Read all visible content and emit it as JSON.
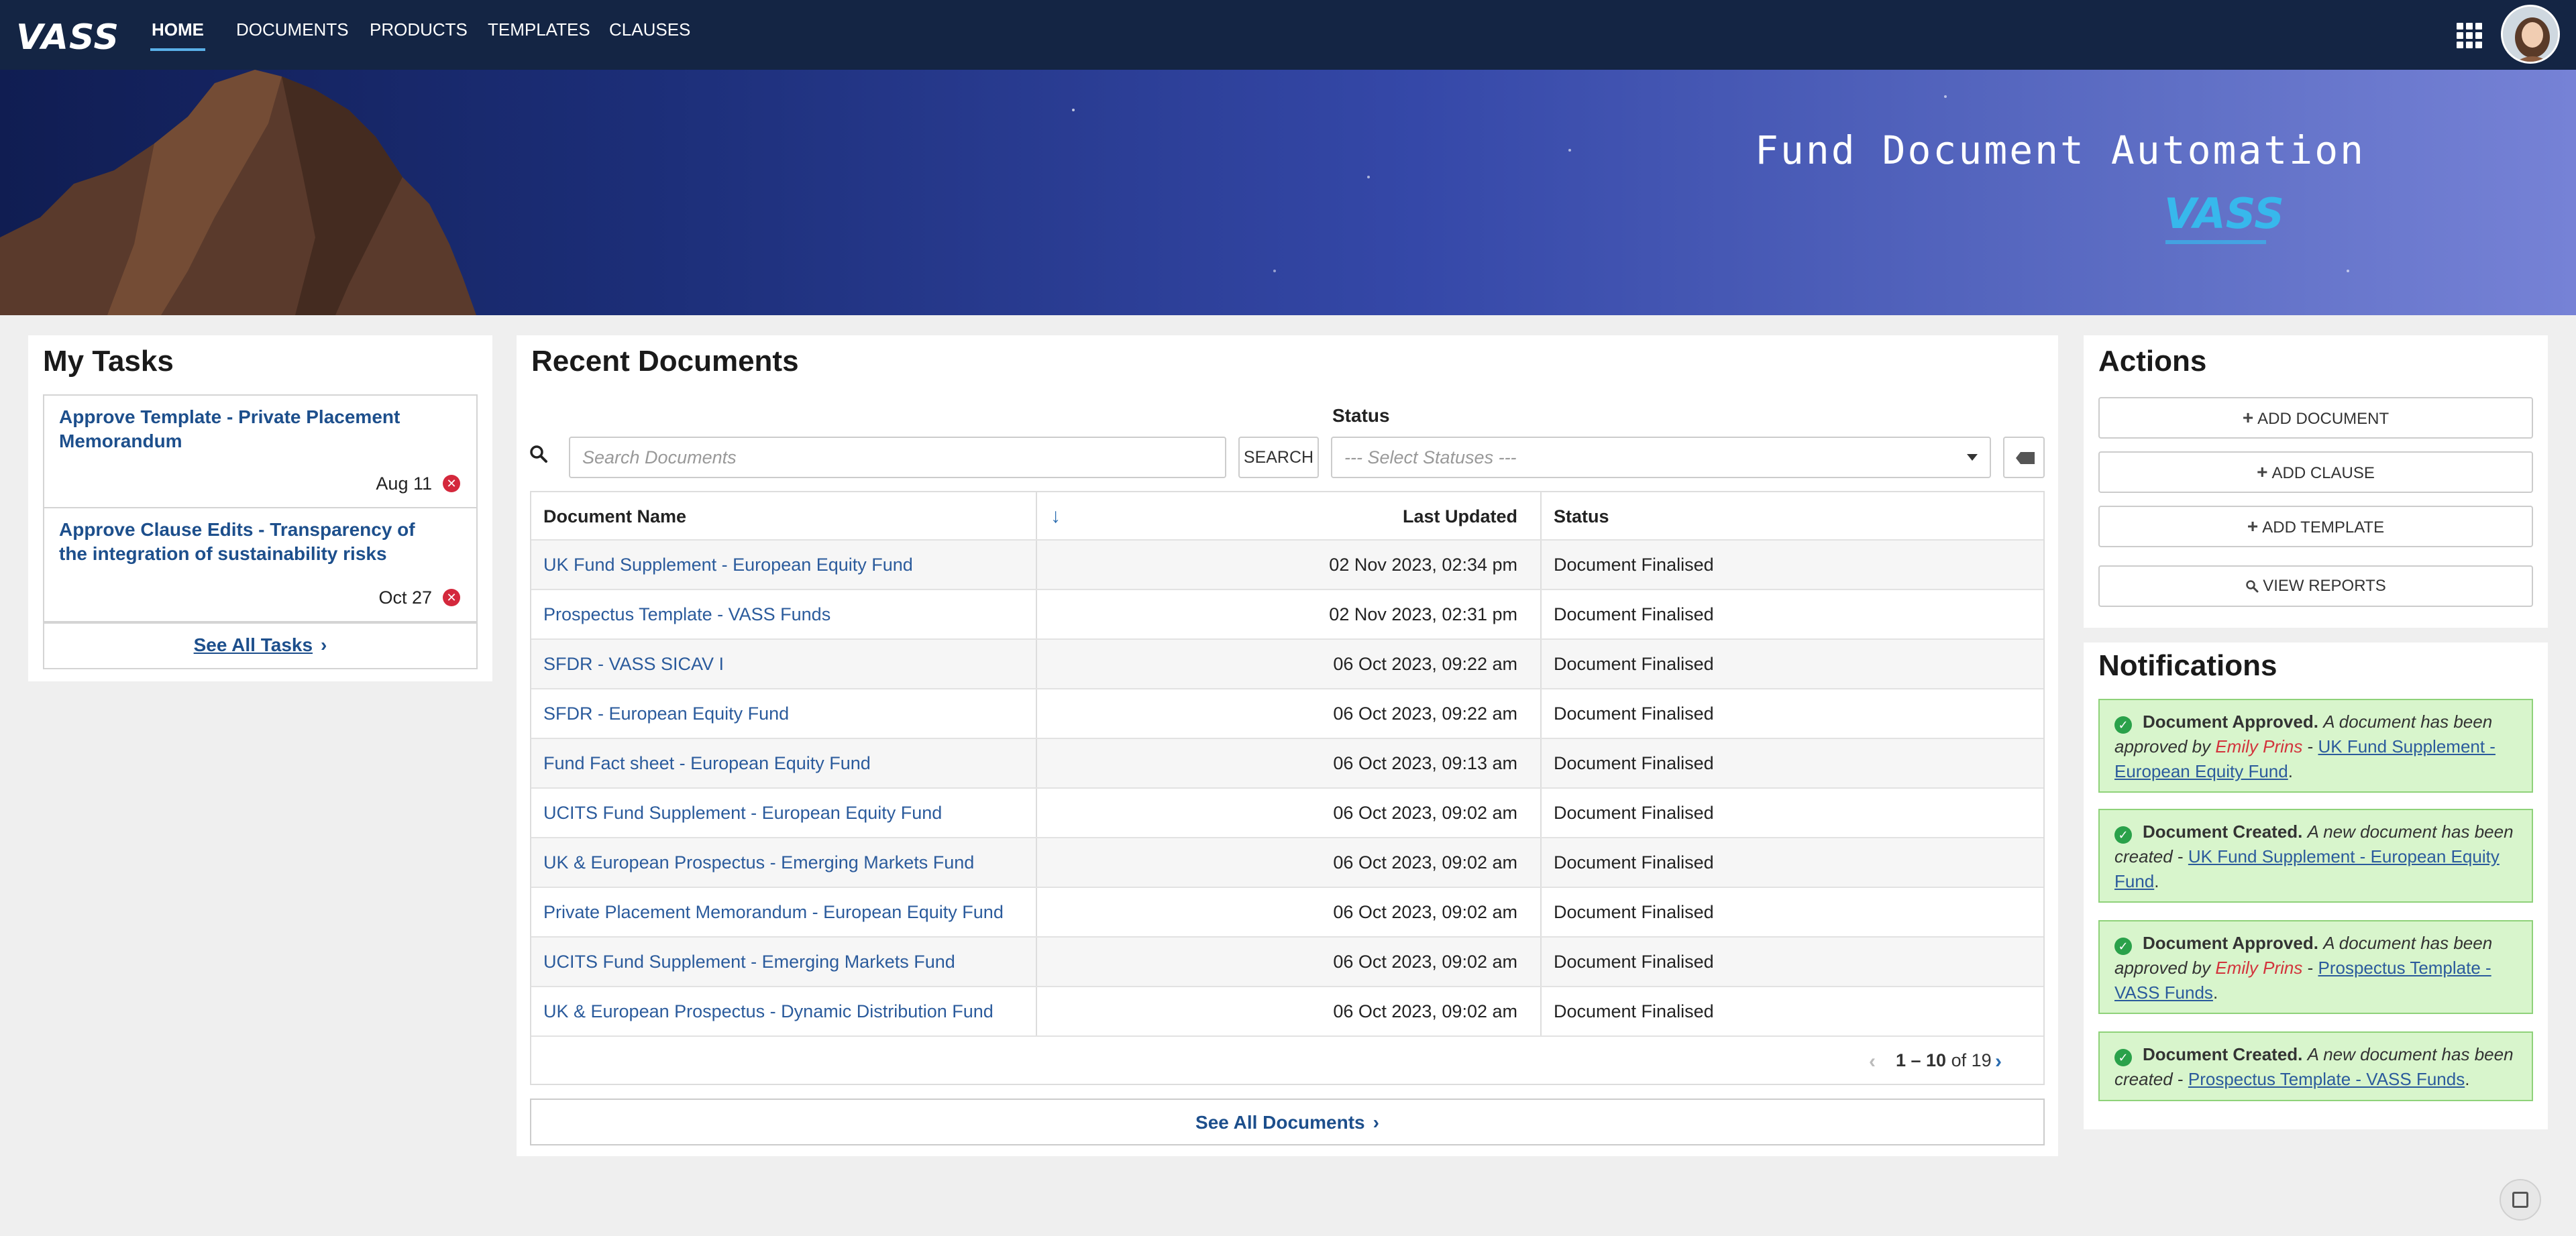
{
  "nav": {
    "logo": "VASS",
    "items": [
      "HOME",
      "DOCUMENTS",
      "PRODUCTS",
      "TEMPLATES",
      "CLAUSES"
    ],
    "active": "HOME",
    "apps_icon": "grid-icon",
    "avatar_icon": "user-avatar"
  },
  "banner": {
    "title": "Fund Document Automation",
    "logo": "VASS"
  },
  "tasks": {
    "title": "My Tasks",
    "items": [
      {
        "title": "Approve Template - Private Placement Memorandum",
        "date": "Aug 11"
      },
      {
        "title": "Approve Clause Edits - Transparency of the integration of sustainability risks",
        "date": "Oct 27"
      }
    ],
    "see_all": "See All Tasks"
  },
  "documents": {
    "title": "Recent Documents",
    "search_placeholder": "Search Documents",
    "search_button": "SEARCH",
    "status_label": "Status",
    "status_placeholder": "--- Select Statuses ---",
    "columns": {
      "name": "Document Name",
      "updated": "Last Updated",
      "status": "Status"
    },
    "rows": [
      {
        "name": "UK Fund Supplement - European Equity Fund",
        "updated": "02 Nov 2023, 02:34 pm",
        "status": "Document Finalised"
      },
      {
        "name": "Prospectus Template - VASS Funds",
        "updated": "02 Nov 2023, 02:31 pm",
        "status": "Document Finalised"
      },
      {
        "name": "SFDR - VASS SICAV I",
        "updated": "06 Oct 2023, 09:22 am",
        "status": "Document Finalised"
      },
      {
        "name": "SFDR - European Equity Fund",
        "updated": "06 Oct 2023, 09:22 am",
        "status": "Document Finalised"
      },
      {
        "name": "Fund Fact sheet - European Equity Fund",
        "updated": "06 Oct 2023, 09:13 am",
        "status": "Document Finalised"
      },
      {
        "name": "UCITS Fund Supplement - European Equity Fund",
        "updated": "06 Oct 2023, 09:02 am",
        "status": "Document Finalised"
      },
      {
        "name": "UK & European Prospectus - Emerging Markets Fund",
        "updated": "06 Oct 2023, 09:02 am",
        "status": "Document Finalised"
      },
      {
        "name": "Private Placement Memorandum - European Equity Fund",
        "updated": "06 Oct 2023, 09:02 am",
        "status": "Document Finalised"
      },
      {
        "name": "UCITS Fund Supplement - Emerging Markets Fund",
        "updated": "06 Oct 2023, 09:02 am",
        "status": "Document Finalised"
      },
      {
        "name": "UK & European Prospectus - Dynamic Distribution Fund",
        "updated": "06 Oct 2023, 09:02 am",
        "status": "Document Finalised"
      }
    ],
    "pager": {
      "range": "1 – 10",
      "of_label": "of",
      "total": "19"
    },
    "see_all": "See All Documents"
  },
  "actions": {
    "title": "Actions",
    "buttons": [
      {
        "label": "ADD DOCUMENT",
        "icon": "plus-icon"
      },
      {
        "label": "ADD CLAUSE",
        "icon": "plus-icon"
      },
      {
        "label": "ADD TEMPLATE",
        "icon": "plus-icon"
      },
      {
        "label": "VIEW REPORTS",
        "icon": "search-icon"
      }
    ]
  },
  "notifications": {
    "title": "Notifications",
    "items": [
      {
        "heading": "Document Approved.",
        "message": "A document has been approved by",
        "user": "Emily Prins",
        "sep": "-",
        "link": "UK Fund Supplement - European Equity Fund"
      },
      {
        "heading": "Document Created.",
        "message": "A new document has been created",
        "user": "",
        "sep": "-",
        "link": "UK Fund Supplement - European Equity Fund"
      },
      {
        "heading": "Document Approved.",
        "message": "A document has been approved by",
        "user": "Emily Prins",
        "sep": "-",
        "link": "Prospectus Template - VASS Funds"
      },
      {
        "heading": "Document Created.",
        "message": "A new document has been created",
        "user": "",
        "sep": "-",
        "link": "Prospectus Template - VASS Funds"
      }
    ]
  },
  "colors": {
    "nav_bg": "#142544",
    "link": "#2b5b9c",
    "accent": "#5ab0e8",
    "success_bg": "#d8f5cc",
    "danger": "#d4283c"
  }
}
